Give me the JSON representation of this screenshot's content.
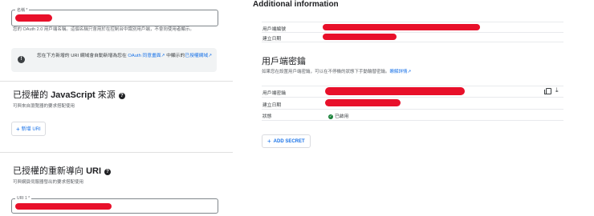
{
  "left": {
    "name_field": {
      "label": "名稱 *"
    },
    "name_helper": "您的 OAuth 2.0 用戶端名稱。這個名稱只會用於在控制台中識別用戶端，不會向使用者顯示。",
    "info_box": {
      "text_before": "您在下方新增的 URI 網域會自動新增為您在 ",
      "link_text": "OAuth 同意畫面",
      "text_after": " 中顯示的",
      "link2_text": "已授權網域"
    },
    "js_origins": {
      "title_prefix": "已授權的 ",
      "title_bold": "JavaScript",
      "title_suffix": " 來源",
      "helper": "可與來自瀏覽器的要求搭配使用",
      "add_uri_label": "新增 URI"
    },
    "redirect_uris": {
      "title_prefix": "已授權的重新導向 ",
      "title_bold": "URI",
      "helper": "可與網頁伺服器發出的要求搭配使用",
      "uri_label": "URI 1 *"
    }
  },
  "right": {
    "additional_info_title": "Additional information",
    "info_rows": [
      {
        "label": "用戶端編號"
      },
      {
        "label": "建立日期"
      }
    ],
    "secrets_title": "用戶端密鑰",
    "secrets_helper": "如果您在設置用戶端密鑰，可以在不停機的狀態下手動輪替密鑰。",
    "secrets_link": "瞭解詳情",
    "secret_rows": [
      {
        "label": "用戶端密鑰"
      },
      {
        "label": "建立日期"
      },
      {
        "label": "狀態",
        "value": "已啟用"
      }
    ],
    "add_secret_label": "ADD SECRET"
  },
  "colors": {
    "accent": "#1a73e8",
    "redaction": "#e8102a",
    "enabled": "#188038"
  },
  "icons": [
    "info-icon",
    "help-icon",
    "plus-icon",
    "copy-icon",
    "download-icon",
    "external-link-icon",
    "check-circle-icon"
  ]
}
